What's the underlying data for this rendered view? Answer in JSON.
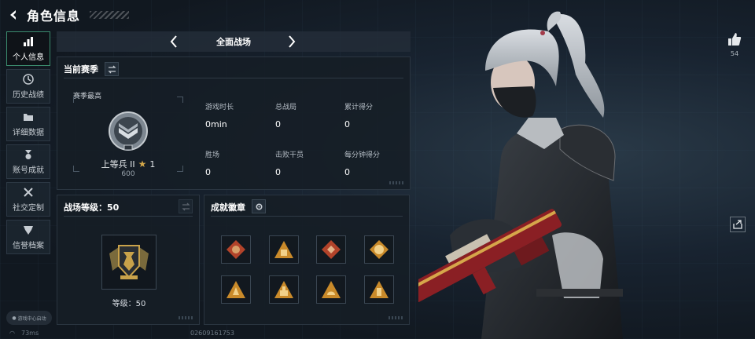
{
  "header": {
    "title": "角色信息"
  },
  "nav": {
    "items": [
      {
        "label": "个人信息",
        "active": true,
        "icon": "bar-chart-icon"
      },
      {
        "label": "历史战绩",
        "active": false,
        "icon": "clock-icon"
      },
      {
        "label": "详细数据",
        "active": false,
        "icon": "folder-icon"
      },
      {
        "label": "账号成就",
        "active": false,
        "icon": "medal-icon"
      },
      {
        "label": "社交定制",
        "active": false,
        "icon": "tools-icon"
      },
      {
        "label": "信誉档案",
        "active": false,
        "icon": "shield-icon"
      }
    ]
  },
  "gamecenter": {
    "label": "游戏中心启动"
  },
  "footer": {
    "ping": "73ms",
    "uid": "02609161753"
  },
  "mode": {
    "current": "全面战场"
  },
  "season": {
    "title": "当前赛季",
    "best_label": "赛季最高",
    "rank_name": "上等兵 II",
    "stars": "1",
    "score": "600",
    "stats": [
      {
        "label": "游戏时长",
        "value": "0min"
      },
      {
        "label": "总战局",
        "value": "0"
      },
      {
        "label": "累计得分",
        "value": "0"
      },
      {
        "label": "胜场",
        "value": "0"
      },
      {
        "label": "击败干员",
        "value": "0"
      },
      {
        "label": "每分钟得分",
        "value": "0"
      }
    ]
  },
  "battle_level": {
    "title": "战场等级：50",
    "level_label": "等级：50"
  },
  "achievements": {
    "title": "成就徽章"
  },
  "social": {
    "likes": "54"
  },
  "colors": {
    "accent": "#3b8c6e",
    "gold": "#c9a24a",
    "badge_red": "#b2432a"
  }
}
